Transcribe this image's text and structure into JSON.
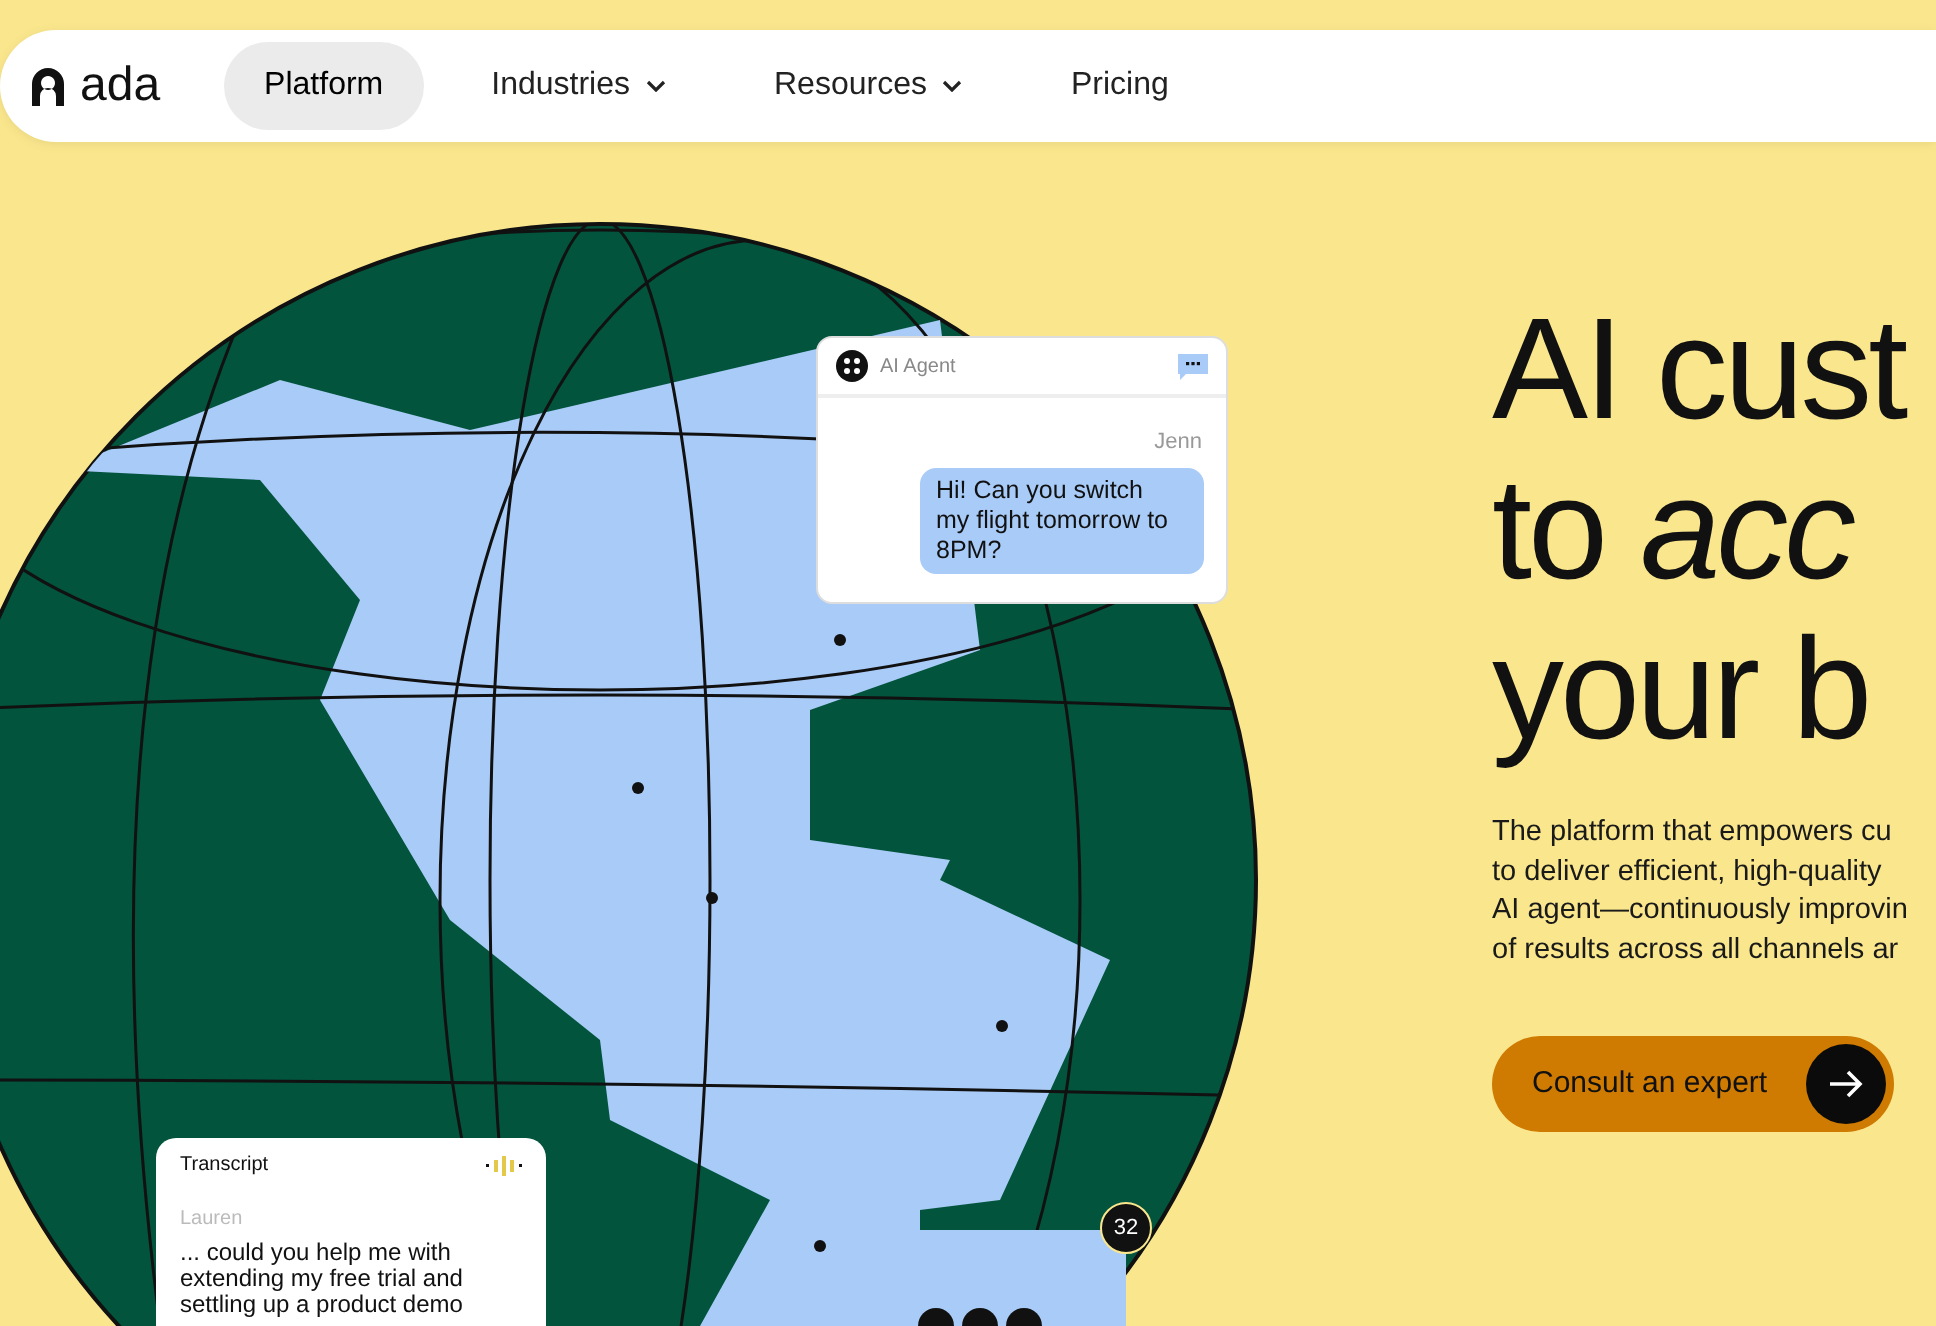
{
  "nav": {
    "logo": "ada",
    "items": [
      {
        "label": "Platform",
        "selected": true,
        "dropdown": false
      },
      {
        "label": "Industries",
        "selected": false,
        "dropdown": true
      },
      {
        "label": "Resources",
        "selected": false,
        "dropdown": true
      },
      {
        "label": "Pricing",
        "selected": false,
        "dropdown": false
      }
    ]
  },
  "hero": {
    "headline": [
      "AI cust",
      "to *acc*",
      "your b"
    ],
    "paragraph": [
      "The platform that empowers cu",
      "to deliver efficient, high-quality",
      "AI agent—continuously improvin",
      "of results across all channels ar"
    ],
    "cta": "Consult an expert"
  },
  "agent_card": {
    "title": "AI Agent",
    "sender": "Jenn",
    "message": "Hi! Can you switch my flight tomorrow to 8PM?"
  },
  "transcript_card": {
    "title": "Transcript",
    "speaker": "Lauren",
    "text": "... could you help me with extending my free trial and settling up a product demo"
  },
  "count_badge": "32"
}
